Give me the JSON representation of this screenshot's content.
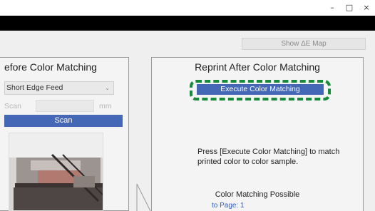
{
  "window": {
    "minimize_glyph": "–",
    "maximize_glyph": "□",
    "close_glyph": "×"
  },
  "toolbar": {
    "show_map_label": "Show ΔE Map"
  },
  "left_panel": {
    "title": "efore Color Matching",
    "feed_select": {
      "value": "Short Edge Feed",
      "chevron": "⌄"
    },
    "scan_label": "Scan",
    "scan_unit": "mm",
    "scan_button_label": "Scan"
  },
  "right_panel": {
    "title": "Reprint After Color Matching",
    "execute_button_label": "Execute Color Matching",
    "instructions": "Press [Execute Color Matching] to match printed color to color sample.",
    "status": "Color Matching Possible",
    "to_page": "to Page:   1"
  },
  "colors": {
    "accent_button": "#4468b6",
    "highlight_dashed": "#188a3c",
    "header_band": "#000000"
  }
}
